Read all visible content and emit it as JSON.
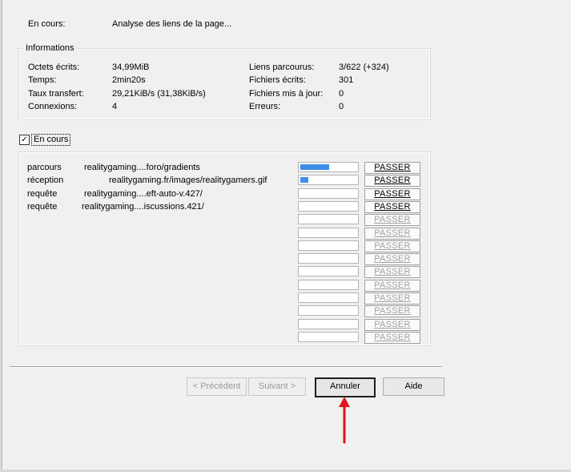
{
  "status": {
    "label": "En cours:",
    "value": "Analyse des liens de la page..."
  },
  "informations": {
    "title": "Informations",
    "left": [
      {
        "label": "Octets écrits:",
        "value": "34,99MiB"
      },
      {
        "label": "Temps:",
        "value": "2min20s"
      },
      {
        "label": "Taux transfert:",
        "value": "29,21KiB/s (31,38KiB/s)"
      },
      {
        "label": "Connexions:",
        "value": "4"
      }
    ],
    "right": [
      {
        "label": "Liens parcourus:",
        "value": "3/622 (+324)"
      },
      {
        "label": "Fichiers écrits:",
        "value": "301"
      },
      {
        "label": "Fichiers mis à jour:",
        "value": "0"
      },
      {
        "label": "Erreurs:",
        "value": "0"
      }
    ]
  },
  "en_cours": {
    "label": "En cours",
    "checked": true,
    "check_glyph": "✓"
  },
  "jobs": [
    {
      "type": "parcours",
      "url": "realitygaming....foro/gradients",
      "progress": 0.52
    },
    {
      "type": "réception",
      "url": "realitygaming.fr/images/realitygamers.gif",
      "progress": 0.14
    },
    {
      "type": "requête",
      "url": "realitygaming....eft-auto-v.427/",
      "progress": 0
    },
    {
      "type": "requête",
      "url": "realitygaming....iscussions.421/",
      "progress": 0
    }
  ],
  "skip_label": "PASSER",
  "skip_row_count": 14,
  "progress_color": "#3c8fe6",
  "buttons": {
    "previous": "< Précédent",
    "next": "Suivant >",
    "cancel": "Annuler",
    "help": "Aide"
  },
  "annotation_color": "#e0141e"
}
